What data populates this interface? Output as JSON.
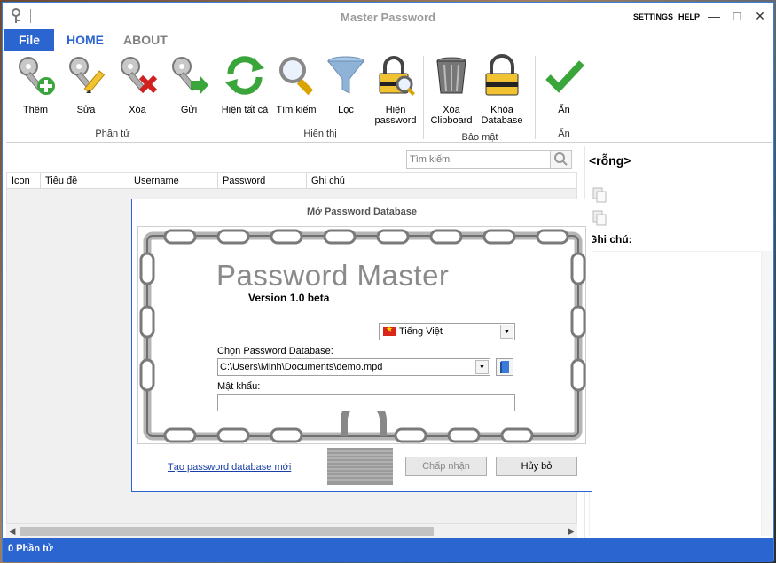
{
  "window": {
    "title": "Master Password",
    "settings_label": "SETTINGS",
    "help_label": "HELP"
  },
  "tabs": [
    {
      "label": "File"
    },
    {
      "label": "HOME"
    },
    {
      "label": "ABOUT"
    }
  ],
  "ribbon": {
    "groups": [
      {
        "label": "Phần tử"
      },
      {
        "label": "Hiển thị"
      },
      {
        "label": "Bảo mật"
      },
      {
        "label": "Ẩn"
      }
    ],
    "buttons": [
      {
        "label": "Thêm",
        "icon": "key-add-icon"
      },
      {
        "label": "Sửa",
        "icon": "key-edit-icon"
      },
      {
        "label": "Xóa",
        "icon": "key-delete-icon"
      },
      {
        "label": "Gửi",
        "icon": "key-send-icon"
      },
      {
        "label": "Hiện tất cả",
        "icon": "refresh-icon"
      },
      {
        "label": "Tìm kiếm",
        "icon": "magnifier-icon"
      },
      {
        "label": "Lọc",
        "icon": "funnel-icon"
      },
      {
        "label": "Hiện password",
        "icon": "lock-search-icon"
      },
      {
        "label": "Xóa Clipboard",
        "icon": "trash-icon"
      },
      {
        "label": "Khóa Database",
        "icon": "padlock-icon"
      },
      {
        "label": "Ẩn",
        "icon": "checkmark-icon"
      }
    ]
  },
  "search": {
    "placeholder": "Tìm kiếm"
  },
  "table": {
    "columns": [
      "Icon",
      "Tiêu đề",
      "Username",
      "Password",
      "Ghi chú"
    ]
  },
  "right_panel": {
    "title": "<rỗng>",
    "notes_label": "Ghi chú:"
  },
  "status": {
    "text": "0 Phần tử"
  },
  "dialog": {
    "title": "Mở Password Database",
    "brand": "Password Master",
    "version": "Version 1.0 beta",
    "language": "Tiếng Việt",
    "db_label": "Chọn Password Database:",
    "db_path": "C:\\Users\\Minh\\Documents\\demo.mpd",
    "password_label": "Mật khẩu:",
    "password_value": "",
    "create_link": "Tạo password database mới",
    "ok_label": "Chấp nhận",
    "cancel_label": "Hủy bỏ"
  },
  "colors": {
    "accent": "#2b65d0",
    "title_gray": "#9b9b9b"
  }
}
